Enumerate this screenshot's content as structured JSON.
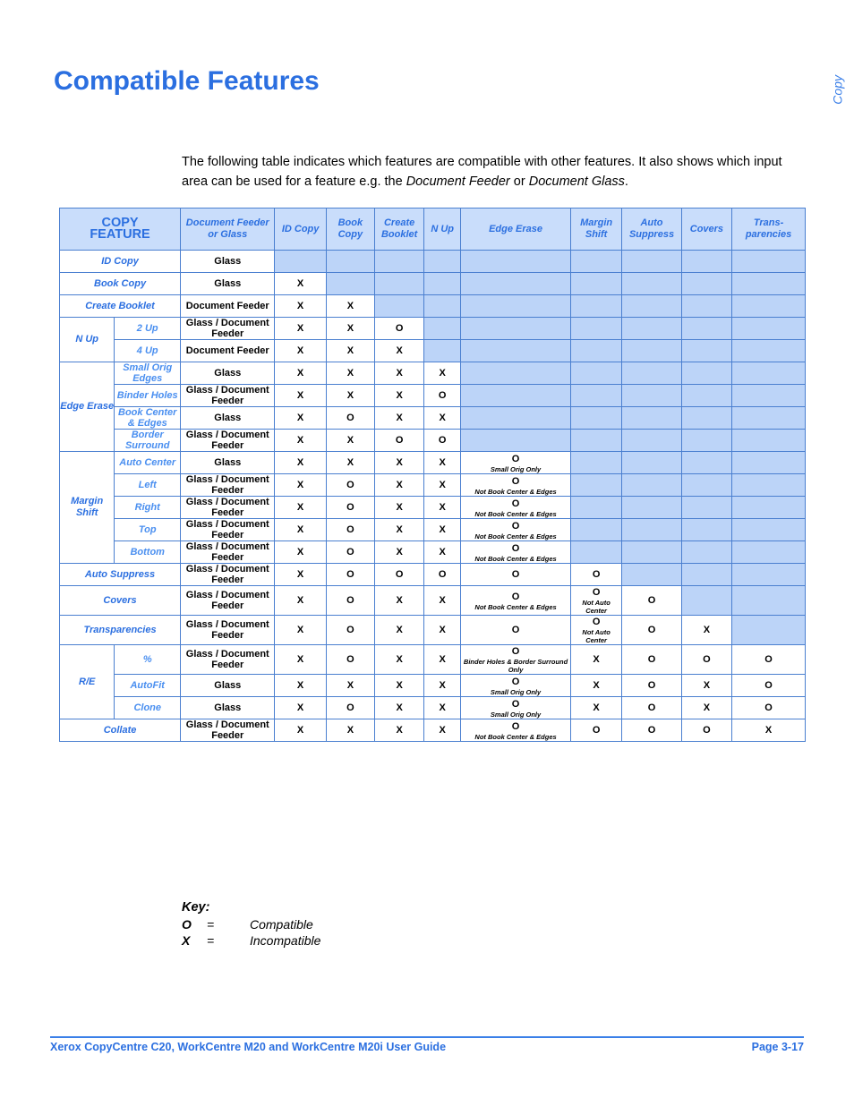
{
  "page": {
    "title": "Compatible Features",
    "side_tab": "Copy",
    "intro_part1": "The following table indicates which features are compatible with other features. It also shows which input area can be used for a feature e.g. the ",
    "intro_em1": "Document Feeder",
    "intro_part2": " or ",
    "intro_em2": "Document Glass",
    "intro_part3": "."
  },
  "table": {
    "headers": {
      "col0": "COPY",
      "col0b": "FEATURE",
      "col2": "Document Feeder or Glass",
      "col3": "ID Copy",
      "col4": "Book Copy",
      "col5": "Create Booklet",
      "col6": "N Up",
      "col7": "Edge Erase",
      "col8": "Margin Shift",
      "col9": "Auto Suppress",
      "col10": "Covers",
      "col11": "Trans- parencies"
    },
    "rows": [
      {
        "group": "",
        "label": "ID Copy",
        "sub": "",
        "source": "Glass",
        "cells": [
          "",
          "",
          "",
          "",
          "",
          "",
          "",
          "",
          ""
        ],
        "notes": [
          "",
          "",
          "",
          "",
          "",
          "",
          "",
          "",
          ""
        ],
        "blue": [
          true,
          true,
          true,
          true,
          true,
          true,
          true,
          true,
          true
        ]
      },
      {
        "group": "",
        "label": "Book Copy",
        "sub": "",
        "source": "Glass",
        "cells": [
          "X",
          "",
          "",
          "",
          "",
          "",
          "",
          "",
          ""
        ],
        "notes": [
          "",
          "",
          "",
          "",
          "",
          "",
          "",
          "",
          ""
        ],
        "blue": [
          false,
          true,
          true,
          true,
          true,
          true,
          true,
          true,
          true
        ]
      },
      {
        "group": "",
        "label": "Create Booklet",
        "sub": "",
        "source": "Document Feeder",
        "cells": [
          "X",
          "X",
          "",
          "",
          "",
          "",
          "",
          "",
          ""
        ],
        "notes": [
          "",
          "",
          "",
          "",
          "",
          "",
          "",
          "",
          ""
        ],
        "blue": [
          false,
          false,
          true,
          true,
          true,
          true,
          true,
          true,
          true
        ]
      },
      {
        "group": "N Up",
        "label": "",
        "sub": "2 Up",
        "source": "Glass / Document Feeder",
        "cells": [
          "X",
          "X",
          "O",
          "",
          "",
          "",
          "",
          "",
          ""
        ],
        "notes": [
          "",
          "",
          "",
          "",
          "",
          "",
          "",
          "",
          ""
        ],
        "blue": [
          false,
          false,
          false,
          true,
          true,
          true,
          true,
          true,
          true
        ]
      },
      {
        "group": "",
        "label": "",
        "sub": "4 Up",
        "source": "Document Feeder",
        "cells": [
          "X",
          "X",
          "X",
          "",
          "",
          "",
          "",
          "",
          ""
        ],
        "notes": [
          "",
          "",
          "",
          "",
          "",
          "",
          "",
          "",
          ""
        ],
        "blue": [
          false,
          false,
          false,
          true,
          true,
          true,
          true,
          true,
          true
        ]
      },
      {
        "group": "Edge Erase",
        "label": "",
        "sub": "Small Orig Edges",
        "source": "Glass",
        "cells": [
          "X",
          "X",
          "X",
          "X",
          "",
          "",
          "",
          "",
          ""
        ],
        "notes": [
          "",
          "",
          "",
          "",
          "",
          "",
          "",
          "",
          ""
        ],
        "blue": [
          false,
          false,
          false,
          false,
          true,
          true,
          true,
          true,
          true
        ]
      },
      {
        "group": "",
        "label": "",
        "sub": "Binder Holes",
        "source": "Glass / Document Feeder",
        "cells": [
          "X",
          "X",
          "X",
          "O",
          "",
          "",
          "",
          "",
          ""
        ],
        "notes": [
          "",
          "",
          "",
          "",
          "",
          "",
          "",
          "",
          ""
        ],
        "blue": [
          false,
          false,
          false,
          false,
          true,
          true,
          true,
          true,
          true
        ]
      },
      {
        "group": "",
        "label": "",
        "sub": "Book Center & Edges",
        "source": "Glass",
        "cells": [
          "X",
          "O",
          "X",
          "X",
          "",
          "",
          "",
          "",
          ""
        ],
        "notes": [
          "",
          "",
          "",
          "",
          "",
          "",
          "",
          "",
          ""
        ],
        "blue": [
          false,
          false,
          false,
          false,
          true,
          true,
          true,
          true,
          true
        ]
      },
      {
        "group": "",
        "label": "",
        "sub": "Border Surround",
        "source": "Glass / Document Feeder",
        "cells": [
          "X",
          "X",
          "O",
          "O",
          "",
          "",
          "",
          "",
          ""
        ],
        "notes": [
          "",
          "",
          "",
          "",
          "",
          "",
          "",
          "",
          ""
        ],
        "blue": [
          false,
          false,
          false,
          false,
          true,
          true,
          true,
          true,
          true
        ]
      },
      {
        "group": "Margin Shift",
        "label": "",
        "sub": "Auto Center",
        "source": "Glass",
        "cells": [
          "X",
          "X",
          "X",
          "X",
          "O",
          "",
          "",
          "",
          ""
        ],
        "notes": [
          "",
          "",
          "",
          "",
          "Small Orig Only",
          "",
          "",
          "",
          ""
        ],
        "blue": [
          false,
          false,
          false,
          false,
          false,
          true,
          true,
          true,
          true
        ]
      },
      {
        "group": "",
        "label": "",
        "sub": "Left",
        "source": "Glass / Document Feeder",
        "cells": [
          "X",
          "O",
          "X",
          "X",
          "O",
          "",
          "",
          "",
          ""
        ],
        "notes": [
          "",
          "",
          "",
          "",
          "Not Book Center & Edges",
          "",
          "",
          "",
          ""
        ],
        "blue": [
          false,
          false,
          false,
          false,
          false,
          true,
          true,
          true,
          true
        ]
      },
      {
        "group": "",
        "label": "",
        "sub": "Right",
        "source": "Glass / Document Feeder",
        "cells": [
          "X",
          "O",
          "X",
          "X",
          "O",
          "",
          "",
          "",
          ""
        ],
        "notes": [
          "",
          "",
          "",
          "",
          "Not Book Center & Edges",
          "",
          "",
          "",
          ""
        ],
        "blue": [
          false,
          false,
          false,
          false,
          false,
          true,
          true,
          true,
          true
        ]
      },
      {
        "group": "",
        "label": "",
        "sub": "Top",
        "source": "Glass / Document Feeder",
        "cells": [
          "X",
          "O",
          "X",
          "X",
          "O",
          "",
          "",
          "",
          ""
        ],
        "notes": [
          "",
          "",
          "",
          "",
          "Not Book Center & Edges",
          "",
          "",
          "",
          ""
        ],
        "blue": [
          false,
          false,
          false,
          false,
          false,
          true,
          true,
          true,
          true
        ]
      },
      {
        "group": "",
        "label": "",
        "sub": "Bottom",
        "source": "Glass / Document Feeder",
        "cells": [
          "X",
          "O",
          "X",
          "X",
          "O",
          "",
          "",
          "",
          ""
        ],
        "notes": [
          "",
          "",
          "",
          "",
          "Not Book Center & Edges",
          "",
          "",
          "",
          ""
        ],
        "blue": [
          false,
          false,
          false,
          false,
          false,
          true,
          true,
          true,
          true
        ]
      },
      {
        "group": "",
        "label": "Auto Suppress",
        "sub": "",
        "source": "Glass / Document Feeder",
        "cells": [
          "X",
          "O",
          "O",
          "O",
          "O",
          "O",
          "",
          "",
          ""
        ],
        "notes": [
          "",
          "",
          "",
          "",
          "",
          "",
          "",
          "",
          ""
        ],
        "blue": [
          false,
          false,
          false,
          false,
          false,
          false,
          true,
          true,
          true
        ]
      },
      {
        "group": "",
        "label": "Covers",
        "sub": "",
        "source": "Glass / Document Feeder",
        "cells": [
          "X",
          "O",
          "X",
          "X",
          "O",
          "O",
          "O",
          "",
          ""
        ],
        "notes": [
          "",
          "",
          "",
          "",
          "Not Book Center & Edges",
          "Not Auto Center",
          "",
          "",
          ""
        ],
        "blue": [
          false,
          false,
          false,
          false,
          false,
          false,
          false,
          true,
          true
        ]
      },
      {
        "group": "",
        "label": "Transparencies",
        "sub": "",
        "source": "Glass / Document Feeder",
        "cells": [
          "X",
          "O",
          "X",
          "X",
          "O",
          "O",
          "O",
          "X",
          ""
        ],
        "notes": [
          "",
          "",
          "",
          "",
          "",
          "Not Auto Center",
          "",
          "",
          ""
        ],
        "blue": [
          false,
          false,
          false,
          false,
          false,
          false,
          false,
          false,
          true
        ]
      },
      {
        "group": "R/E",
        "label": "",
        "sub": "%",
        "source": "Glass / Document Feeder",
        "cells": [
          "X",
          "O",
          "X",
          "X",
          "O",
          "X",
          "O",
          "O",
          "O"
        ],
        "notes": [
          "",
          "",
          "",
          "",
          "Binder Holes & Border Surround Only",
          "",
          "",
          "",
          ""
        ],
        "blue": [
          false,
          false,
          false,
          false,
          false,
          false,
          false,
          false,
          false
        ]
      },
      {
        "group": "",
        "label": "",
        "sub": "AutoFit",
        "source": "Glass",
        "cells": [
          "X",
          "X",
          "X",
          "X",
          "O",
          "X",
          "O",
          "X",
          "O"
        ],
        "notes": [
          "",
          "",
          "",
          "",
          "Small Orig Only",
          "",
          "",
          "",
          ""
        ],
        "blue": [
          false,
          false,
          false,
          false,
          false,
          false,
          false,
          false,
          false
        ]
      },
      {
        "group": "",
        "label": "",
        "sub": "Clone",
        "source": "Glass",
        "cells": [
          "X",
          "O",
          "X",
          "X",
          "O",
          "X",
          "O",
          "X",
          "O"
        ],
        "notes": [
          "",
          "",
          "",
          "",
          "Small Orig Only",
          "",
          "",
          "",
          ""
        ],
        "blue": [
          false,
          false,
          false,
          false,
          false,
          false,
          false,
          false,
          false
        ]
      },
      {
        "group": "",
        "label": "Collate",
        "sub": "",
        "source": "Glass / Document Feeder",
        "cells": [
          "X",
          "X",
          "X",
          "X",
          "O",
          "O",
          "O",
          "O",
          "X"
        ],
        "notes": [
          "",
          "",
          "",
          "",
          "Not Book Center & Edges",
          "",
          "",
          "",
          ""
        ],
        "blue": [
          false,
          false,
          false,
          false,
          false,
          false,
          false,
          false,
          false
        ]
      }
    ]
  },
  "key": {
    "title": "Key:",
    "rows": [
      {
        "symbol": "O",
        "eq": "=",
        "meaning": "Compatible"
      },
      {
        "symbol": "X",
        "eq": "=",
        "meaning": "Incompatible"
      }
    ]
  },
  "footer": {
    "left": "Xerox CopyCentre C20, WorkCentre M20 and WorkCentre M20i User Guide",
    "right": "Page 3-17"
  }
}
